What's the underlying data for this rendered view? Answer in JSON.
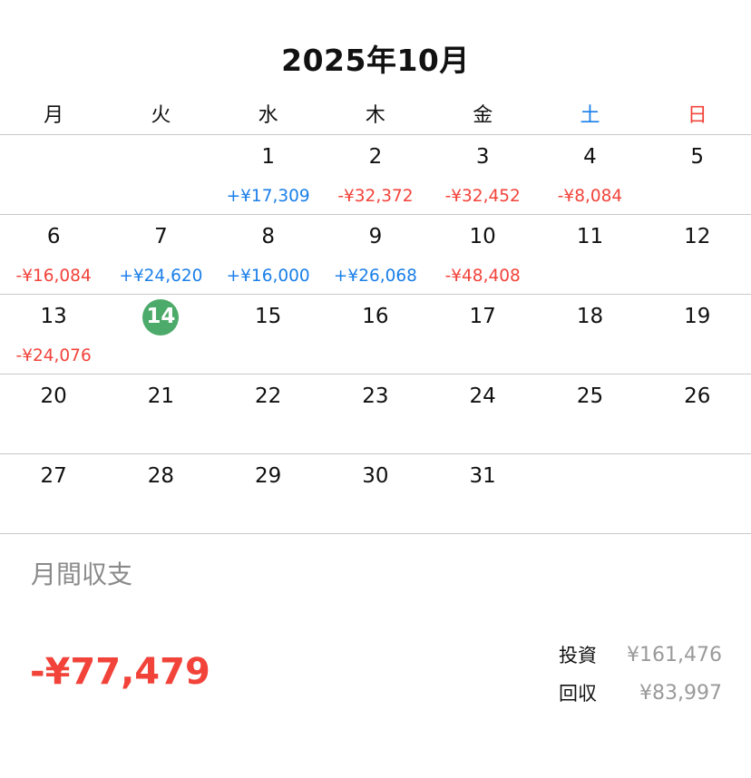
{
  "header": {
    "title": "2025年10月"
  },
  "colors": {
    "positive": "#1a7fe8",
    "negative": "#f2433a",
    "saturday": "#1a7fe8",
    "sunday": "#f2433a",
    "today": "#4caa6a"
  },
  "weekdays": [
    "月",
    "火",
    "水",
    "木",
    "金",
    "土",
    "日"
  ],
  "today": 14,
  "weeks": [
    [
      {
        "day": "",
        "amount": ""
      },
      {
        "day": "",
        "amount": ""
      },
      {
        "day": "1",
        "amount": "+¥17,309"
      },
      {
        "day": "2",
        "amount": "-¥32,372"
      },
      {
        "day": "3",
        "amount": "-¥32,452"
      },
      {
        "day": "4",
        "amount": "-¥8,084"
      },
      {
        "day": "5",
        "amount": ""
      }
    ],
    [
      {
        "day": "6",
        "amount": "-¥16,084"
      },
      {
        "day": "7",
        "amount": "+¥24,620"
      },
      {
        "day": "8",
        "amount": "+¥16,000"
      },
      {
        "day": "9",
        "amount": "+¥26,068"
      },
      {
        "day": "10",
        "amount": "-¥48,408"
      },
      {
        "day": "11",
        "amount": ""
      },
      {
        "day": "12",
        "amount": ""
      }
    ],
    [
      {
        "day": "13",
        "amount": "-¥24,076"
      },
      {
        "day": "14",
        "amount": ""
      },
      {
        "day": "15",
        "amount": ""
      },
      {
        "day": "16",
        "amount": ""
      },
      {
        "day": "17",
        "amount": ""
      },
      {
        "day": "18",
        "amount": ""
      },
      {
        "day": "19",
        "amount": ""
      }
    ],
    [
      {
        "day": "20",
        "amount": ""
      },
      {
        "day": "21",
        "amount": ""
      },
      {
        "day": "22",
        "amount": ""
      },
      {
        "day": "23",
        "amount": ""
      },
      {
        "day": "24",
        "amount": ""
      },
      {
        "day": "25",
        "amount": ""
      },
      {
        "day": "26",
        "amount": ""
      }
    ],
    [
      {
        "day": "27",
        "amount": ""
      },
      {
        "day": "28",
        "amount": ""
      },
      {
        "day": "29",
        "amount": ""
      },
      {
        "day": "30",
        "amount": ""
      },
      {
        "day": "31",
        "amount": ""
      },
      {
        "day": "",
        "amount": ""
      },
      {
        "day": "",
        "amount": ""
      }
    ]
  ],
  "summary": {
    "label": "月間収支",
    "total": "-¥77,479",
    "investment_label": "投資",
    "investment_value": "¥161,476",
    "return_label": "回収",
    "return_value": "¥83,997"
  }
}
